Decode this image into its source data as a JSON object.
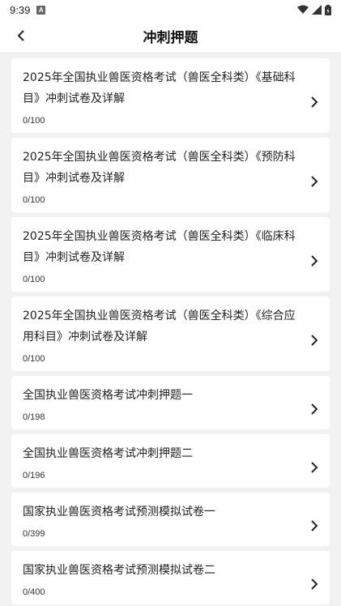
{
  "status_bar": {
    "time": "9:39",
    "notification_icon": "a-icon",
    "icons": [
      "wifi-icon",
      "signal-icon",
      "battery-icon"
    ]
  },
  "header": {
    "title": "冲刺押题",
    "back_icon": "chevron-left-icon"
  },
  "items": [
    {
      "title": "2025年全国执业兽医资格考试（兽医全科类）《基础科目》冲刺试卷及详解",
      "progress": "0/100"
    },
    {
      "title": "2025年全国执业兽医资格考试（兽医全科类）《预防科目》冲刺试卷及详解",
      "progress": "0/100"
    },
    {
      "title": "2025年全国执业兽医资格考试（兽医全科类）《临床科目》冲刺试卷及详解",
      "progress": "0/100"
    },
    {
      "title": "2025年全国执业兽医资格考试（兽医全科类）《综合应用科目》冲刺试卷及详解",
      "progress": "0/100"
    },
    {
      "title": "全国执业兽医资格考试冲刺押题一",
      "progress": "0/198"
    },
    {
      "title": "全国执业兽医资格考试冲刺押题二",
      "progress": "0/196"
    },
    {
      "title": "国家执业兽医资格考试预测模拟试卷一",
      "progress": "0/399"
    },
    {
      "title": "国家执业兽医资格考试预测模拟试卷二",
      "progress": "0/400"
    }
  ],
  "colors": {
    "background": "#f2f2f2",
    "card": "#ffffff",
    "text": "#222222"
  }
}
